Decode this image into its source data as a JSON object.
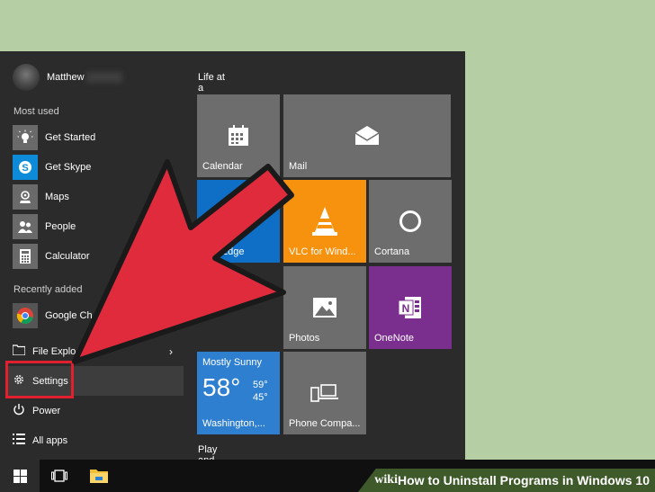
{
  "user": {
    "name": "Matthew"
  },
  "sections": {
    "most_used": "Most used",
    "recently_added": "Recently added"
  },
  "most_used": [
    {
      "label": "Get Started"
    },
    {
      "label": "Get Skype"
    },
    {
      "label": "Maps"
    },
    {
      "label": "People"
    },
    {
      "label": "Calculator"
    }
  ],
  "recently_added": [
    {
      "label": "Google Ch"
    }
  ],
  "bottom_items": {
    "file_explorer": "File Explo",
    "settings": "Settings",
    "power": "Power",
    "all_apps": "All apps"
  },
  "tile_groups": {
    "life": "Life at a glance",
    "play": "Play and explore"
  },
  "tiles": {
    "calendar": "Calendar",
    "mail": "Mail",
    "edge": "soft Edge",
    "vlc": "VLC for Wind...",
    "cortana": "Cortana",
    "photos": "Photos",
    "onenote": "OneNote",
    "phone": "Phone Compa..."
  },
  "weather": {
    "condition": "Mostly Sunny",
    "temp": "58°",
    "high": "59°",
    "low": "45°",
    "location": "Washington,..."
  },
  "banner": {
    "wiki": "wiki",
    "how": "How",
    "title": "to Uninstall Programs in Windows 10"
  },
  "colors": {
    "background": "#b5cea3",
    "start_menu": "#2b2b2b",
    "tile_grey": "#6d6d6d",
    "edge_blue": "#0f6fc6",
    "vlc_orange": "#f7920f",
    "onenote_purple": "#7a2e8e",
    "weather_blue": "#2f7fd0",
    "arrow_red": "#e02b3c"
  }
}
